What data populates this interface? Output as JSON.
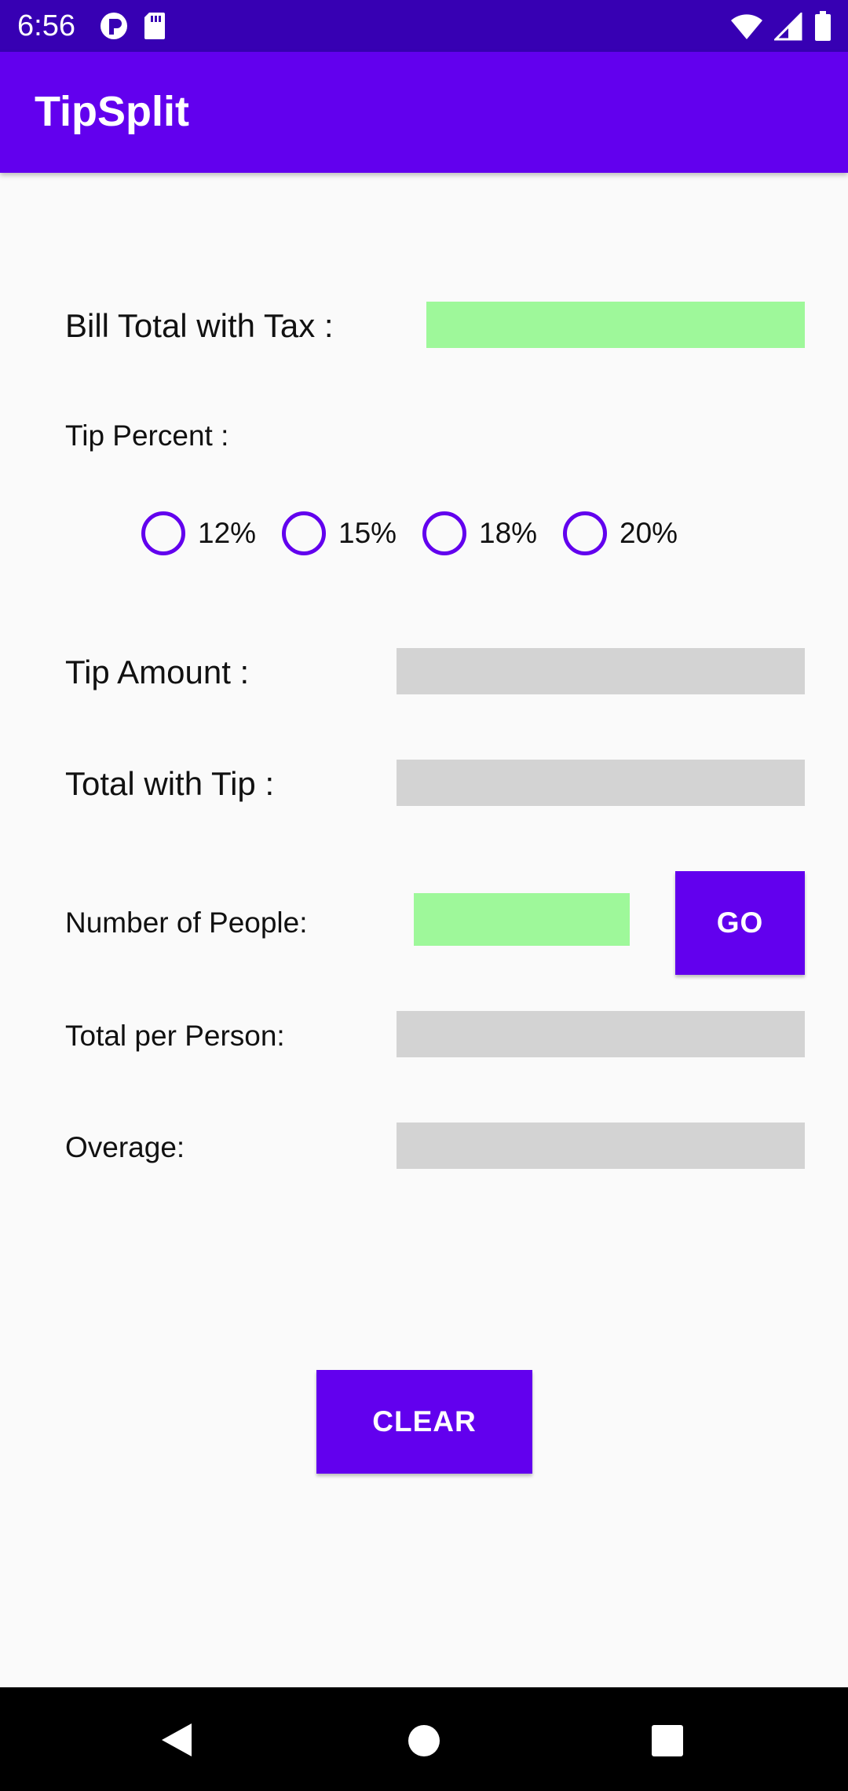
{
  "status_bar": {
    "time": "6:56",
    "left_icons": [
      "app-notification-icon",
      "sd-card-icon"
    ],
    "right_icons": [
      "wifi-icon",
      "cell-signal-icon",
      "battery-icon"
    ]
  },
  "app_bar": {
    "title": "TipSplit"
  },
  "form": {
    "bill_label": "Bill Total with Tax :",
    "bill_value": "",
    "tip_percent_label": "Tip Percent  :",
    "tip_options": [
      {
        "label": "12%",
        "checked": false
      },
      {
        "label": "15%",
        "checked": false
      },
      {
        "label": "18%",
        "checked": false
      },
      {
        "label": "20%",
        "checked": false
      }
    ],
    "tip_amount_label": "Tip Amount :",
    "tip_amount_value": "",
    "total_with_tip_label": "Total with Tip :",
    "total_with_tip_value": "",
    "people_label": "Number of People:",
    "people_value": "",
    "go_label": "GO",
    "per_person_label": "Total per Person:",
    "per_person_value": "",
    "overage_label": "Overage:",
    "overage_value": "",
    "clear_label": "CLEAR"
  },
  "colors": {
    "status_bar": "#3700b3",
    "primary": "#6200ee",
    "input_field": "#9ef89a",
    "output_field": "#d3d3d3"
  }
}
